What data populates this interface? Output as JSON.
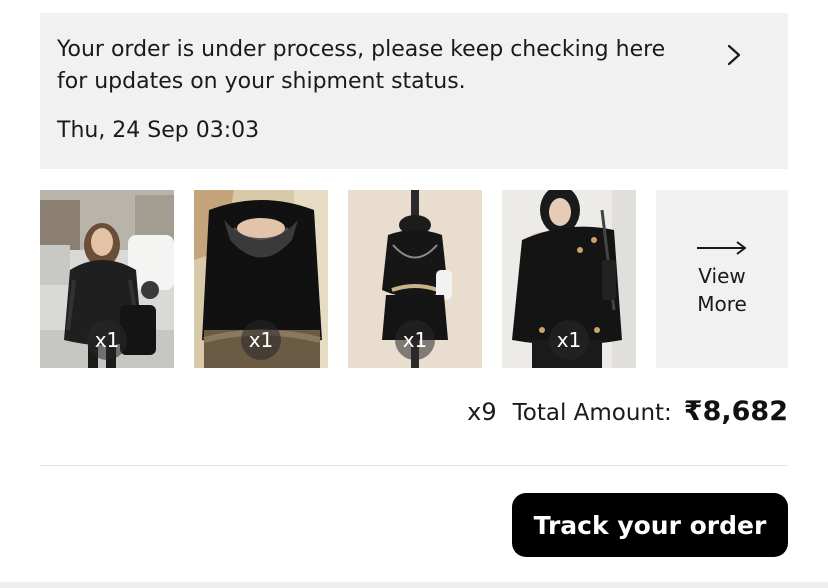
{
  "status_card": {
    "message": "Your order is under process, please keep checking here for updates on your shipment status.",
    "timestamp": "Thu, 24 Sep 03:03",
    "chevron_icon": "chevron-right-icon"
  },
  "items": [
    {
      "quantity": "x1",
      "description_icon": "product-photo-fur-coat"
    },
    {
      "quantity": "x1",
      "description_icon": "product-photo-lace-top"
    },
    {
      "quantity": "x1",
      "description_icon": "product-photo-halter-set"
    },
    {
      "quantity": "x1",
      "description_icon": "product-photo-off-shoulder-top"
    }
  ],
  "view_more": {
    "label": "View\nMore",
    "icon": "arrow-right-icon"
  },
  "summary": {
    "item_count": "x9",
    "total_label": "Total Amount:",
    "total_amount": "₹8,682"
  },
  "actions": {
    "track_label": "Track your order"
  },
  "colors": {
    "card_background": "#f1f1f1",
    "button_background": "#000000",
    "button_text": "#ffffff"
  }
}
